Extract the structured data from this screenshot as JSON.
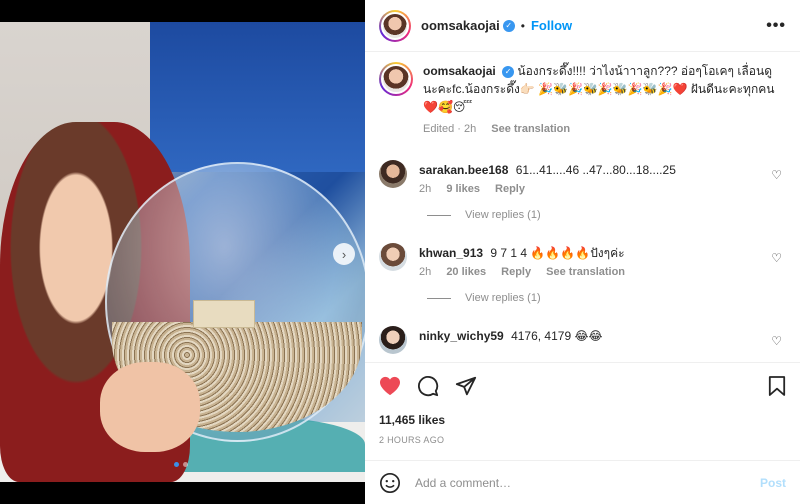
{
  "post": {
    "username": "oomsakaojai",
    "follow_label": "Follow",
    "more_label": "•••",
    "bullet": "•"
  },
  "caption": {
    "username": "oomsakaojai",
    "text": "น้องกระดึ๊ง!!!! ว่าไงน้าาาลูก??? อ่อๆโอเคๆ เลื่อนดูนะคะfc.น้องกระดึ๊ง👉🏻 🎉🐝🎉🐝🎉🐝🎉🐝🎉❤️ ฝันดีนะคะทุกคน ❤️🥰😴",
    "edited": "Edited · 2h",
    "see_translation": "See translation"
  },
  "comments": [
    {
      "username": "sarakan.bee168",
      "text": "61...41....46 ..47...80...18....25",
      "time": "2h",
      "likes": "9 likes",
      "reply": "Reply",
      "view_replies": "View replies (1)"
    },
    {
      "username": "khwan_913",
      "text": "9 7 1 4 🔥🔥🔥🔥ปังๆค่ะ",
      "time": "2h",
      "likes": "20 likes",
      "reply": "Reply",
      "see_translation": "See translation",
      "view_replies": "View replies (1)"
    },
    {
      "username": "ninky_wichy59",
      "text": "4176, 4179 😂😂"
    }
  ],
  "likes_count": "11,465 likes",
  "time_ago": "2 HOURS AGO",
  "add_comment": {
    "placeholder": "Add a comment…",
    "post_label": "Post"
  },
  "icons": {
    "like": "heart-filled-icon",
    "comment": "comment-icon",
    "share": "share-icon",
    "save": "bookmark-icon",
    "emoji": "emoji-icon",
    "next": "chevron-right-icon"
  },
  "colors": {
    "like_red": "#ed4956",
    "link_blue": "#0095f6",
    "post_disabled": "#b2dffc"
  }
}
